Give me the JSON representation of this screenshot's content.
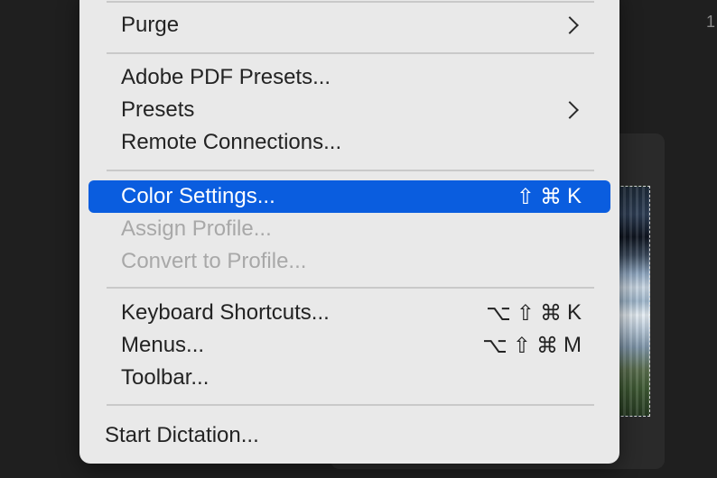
{
  "background": {
    "corner_text": "1"
  },
  "menu": {
    "items": [
      {
        "label": "Purge",
        "submenu": true
      },
      {
        "label": "Adobe PDF Presets..."
      },
      {
        "label": "Presets",
        "submenu": true
      },
      {
        "label": "Remote Connections..."
      },
      {
        "label": "Color Settings...",
        "shortcut": "⇧⌘K",
        "selected": true
      },
      {
        "label": "Assign Profile...",
        "disabled": true
      },
      {
        "label": "Convert to Profile...",
        "disabled": true
      },
      {
        "label": "Keyboard Shortcuts...",
        "shortcut": "⌥⇧⌘K"
      },
      {
        "label": "Menus...",
        "shortcut": "⌥⇧⌘M"
      },
      {
        "label": "Toolbar..."
      },
      {
        "label": "Start Dictation..."
      }
    ],
    "shortcut_keys": {
      "color_settings": [
        "⇧",
        "⌘",
        "K"
      ],
      "keyboard_shortcuts": [
        "⌥",
        "⇧",
        "⌘",
        "K"
      ],
      "menus": [
        "⌥",
        "⇧",
        "⌘",
        "M"
      ]
    }
  },
  "colors": {
    "selection": "#0a5ddf",
    "menu_bg": "#e9e9e9",
    "disabled_text": "#a8a8a8"
  }
}
